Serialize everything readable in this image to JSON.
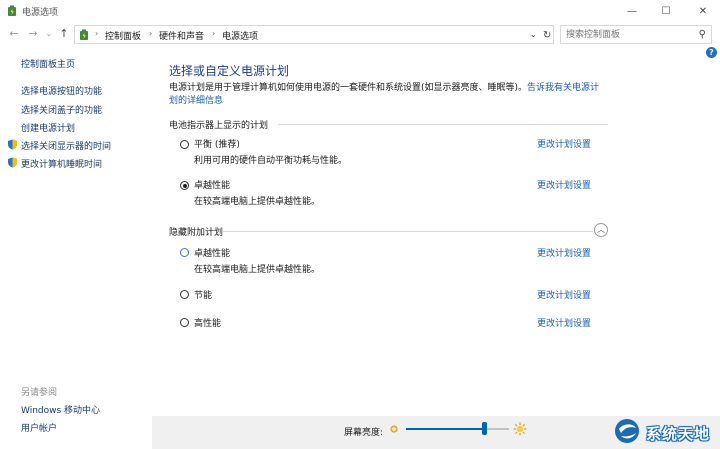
{
  "window": {
    "title": "电源选项",
    "controls": [
      "—",
      "☐",
      "✕"
    ]
  },
  "navigation": {
    "back": "←",
    "forward": "→",
    "recent": "⌄",
    "up": "↑",
    "breadcrumbs": [
      "控制面板",
      "硬件和声音",
      "电源选项"
    ],
    "search_placeholder": "搜索控制面板"
  },
  "sidebar": {
    "home": "控制面板主页",
    "links": [
      {
        "label": "选择电源按钮的功能",
        "shield": false
      },
      {
        "label": "选择关闭盖子的功能",
        "shield": false
      },
      {
        "label": "创建电源计划",
        "shield": false
      },
      {
        "label": "选择关闭显示器的时间",
        "shield": true
      },
      {
        "label": "更改计算机睡眠时间",
        "shield": true
      }
    ],
    "see_also_title": "另请参阅",
    "see_also": [
      "Windows 移动中心",
      "用户帐户"
    ]
  },
  "main": {
    "title": "选择或自定义电源计划",
    "description_line1": "电源计划是用于管理计算机如何使用电源的一套硬件和系统设置(如显示器亮度、睡眠等)。",
    "description_link1": "告诉我有关电源计",
    "description_link2": "划的详细信息",
    "section_battery": "电池指示器上显示的计划",
    "section_hidden": "隐藏附加计划",
    "collapse_icon": "︿",
    "change_label": "更改计划设置",
    "battery_plans": [
      {
        "name": "平衡 (推荐)",
        "desc": "利用可用的硬件自动平衡功耗与性能。",
        "checked": false
      },
      {
        "name": "卓越性能",
        "desc": "在较高端电脑上提供卓越性能。",
        "checked": true
      }
    ],
    "hidden_plans": [
      {
        "name": "卓越性能",
        "desc": "在较高端电脑上提供卓越性能。",
        "checked": false
      },
      {
        "name": "节能",
        "desc": "",
        "checked": false
      },
      {
        "name": "高性能",
        "desc": "",
        "checked": false
      }
    ]
  },
  "brightness": {
    "label": "屏幕亮度:",
    "level": 0.76
  },
  "watermark": {
    "text": "系统天地"
  },
  "colors": {
    "accent": "#0063b1",
    "link": "#1a5fb4",
    "title": "#1d3d8c"
  }
}
